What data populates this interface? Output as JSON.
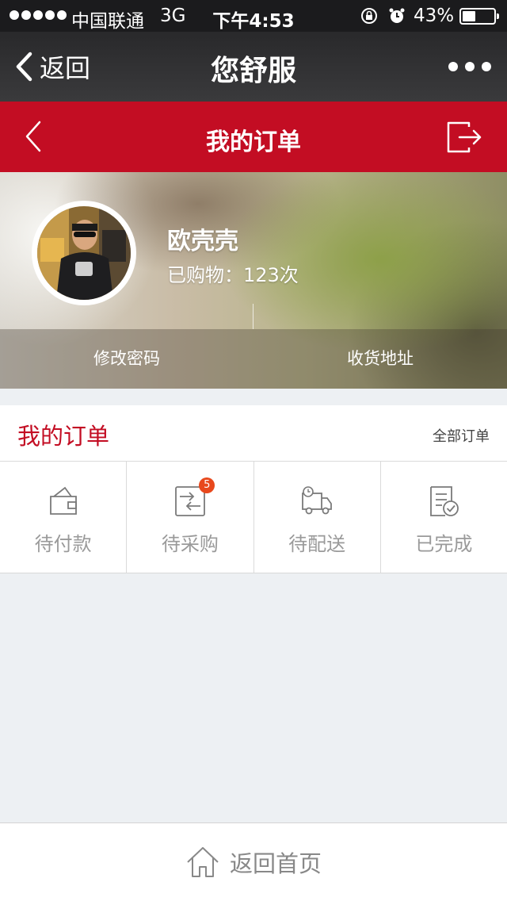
{
  "status_bar": {
    "carrier": "中国联通",
    "network": "3G",
    "time": "下午4:53",
    "battery_percent_text": "43%",
    "battery_level": 0.43
  },
  "nav_bar": {
    "back_label": "返回",
    "title": "您舒服"
  },
  "page_header": {
    "title": "我的订单"
  },
  "profile": {
    "username": "欧壳壳",
    "purchase_text": "已购物：123次",
    "actions": [
      "修改密码",
      "收货地址"
    ]
  },
  "orders": {
    "title": "我的订单",
    "all_label": "全部订单",
    "items": [
      {
        "label": "待付款",
        "icon": "wallet-icon"
      },
      {
        "label": "待采购",
        "icon": "exchange-icon",
        "badge": "5"
      },
      {
        "label": "待配送",
        "icon": "truck-icon"
      },
      {
        "label": "已完成",
        "icon": "completed-icon"
      }
    ]
  },
  "bottom_bar": {
    "home_label": "返回首页"
  },
  "colors": {
    "brand_red": "#c30d23",
    "badge": "#e8481c",
    "nav_dark": "#2e2e30",
    "background": "#edf0f3"
  }
}
